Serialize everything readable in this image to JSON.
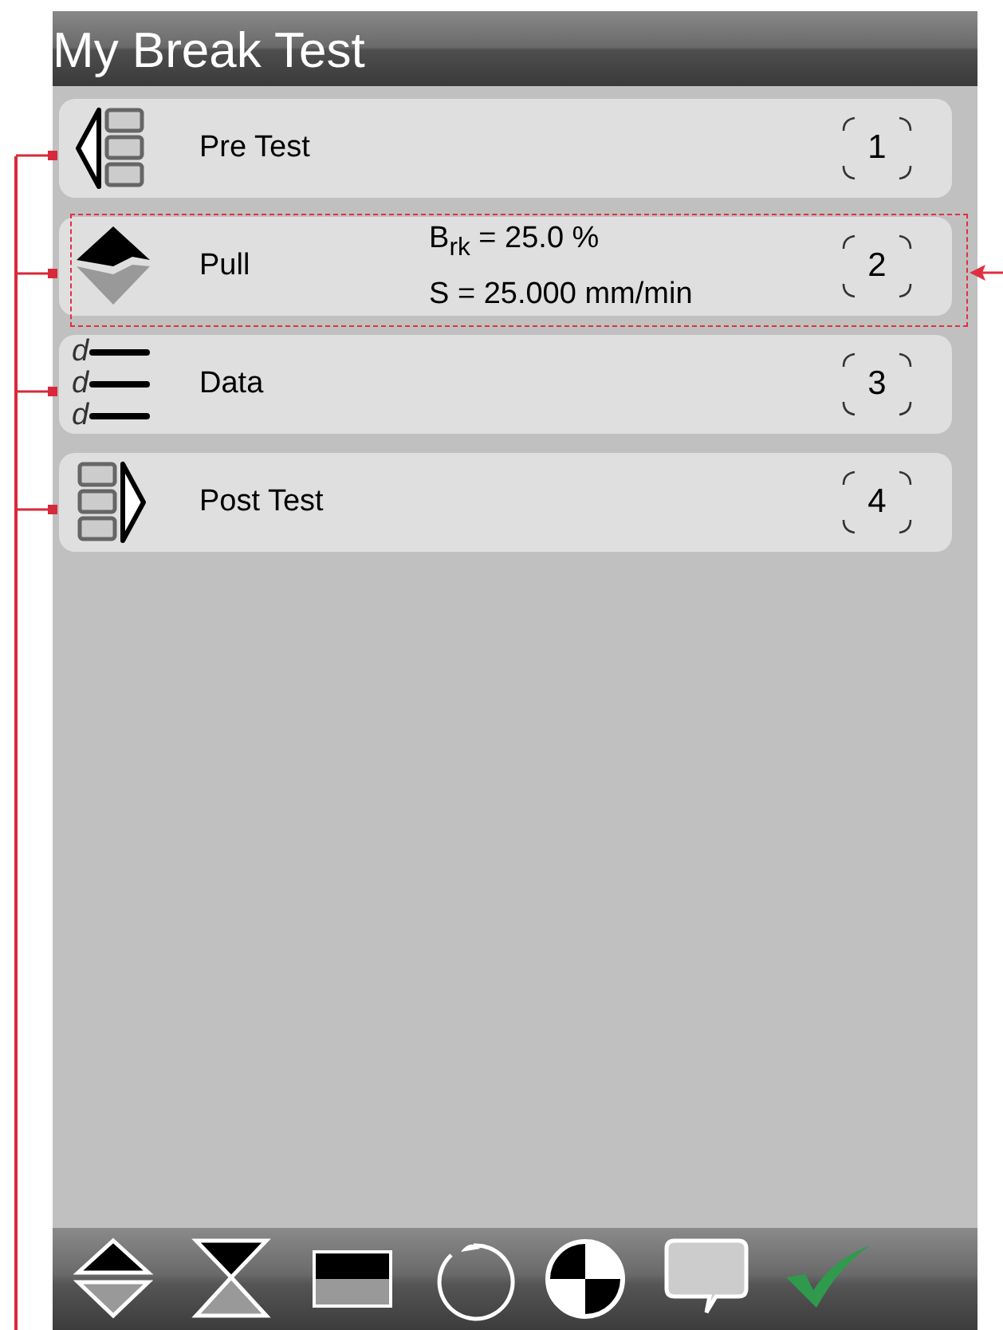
{
  "window": {
    "title": "My Break Test"
  },
  "steps": [
    {
      "kind": "pre",
      "label": "Pre Test",
      "number": "1",
      "highlighted": false,
      "bracketed": true
    },
    {
      "kind": "pull",
      "label": "Pull",
      "params": [
        "B$_{rk}$ = 25.0 %",
        "S = 25.000 mm/min"
      ],
      "number": "2",
      "highlighted": true,
      "bracketed": true
    },
    {
      "kind": "data",
      "label": "Data",
      "icon_letters": [
        "d",
        "d",
        "d"
      ],
      "number": "3",
      "highlighted": false,
      "bracketed": true
    },
    {
      "kind": "post",
      "label": "Post Test",
      "number": "4",
      "highlighted": false,
      "bracketed": true
    }
  ],
  "toolbar": [
    {
      "kind": "up-down"
    },
    {
      "kind": "hourglass"
    },
    {
      "kind": "split-rect"
    },
    {
      "kind": "rotate"
    },
    {
      "kind": "target"
    },
    {
      "kind": "comment"
    },
    {
      "kind": "check"
    }
  ]
}
